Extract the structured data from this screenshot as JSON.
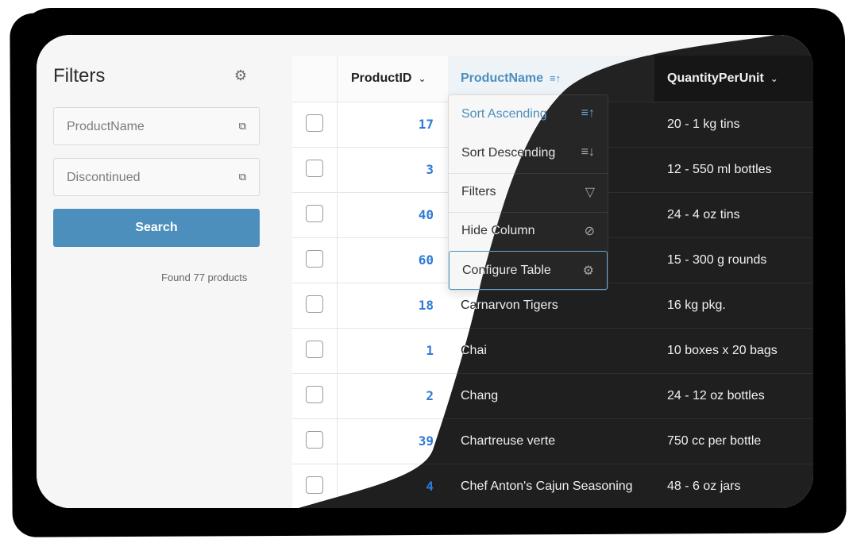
{
  "sidebar": {
    "title": "Filters",
    "fields": [
      {
        "placeholder": "ProductName"
      },
      {
        "placeholder": "Discontinued"
      }
    ],
    "search_label": "Search",
    "found_text": "Found 77 products"
  },
  "table": {
    "columns": [
      {
        "label": "ProductID"
      },
      {
        "label": "ProductName"
      },
      {
        "label": "QuantityPerUnit"
      }
    ],
    "rows": [
      {
        "id": "17",
        "name": "",
        "qty": "20 - 1 kg tins"
      },
      {
        "id": "3",
        "name": "",
        "qty": "12 - 550 ml bottles"
      },
      {
        "id": "40",
        "name": "",
        "qty": "24 - 4 oz tins"
      },
      {
        "id": "60",
        "name": "",
        "qty": "15 - 300 g rounds"
      },
      {
        "id": "18",
        "name": "Carnarvon Tigers",
        "qty": "16 kg pkg."
      },
      {
        "id": "1",
        "name": "Chai",
        "qty": "10 boxes x 20 bags"
      },
      {
        "id": "2",
        "name": "Chang",
        "qty": "24 - 12 oz bottles"
      },
      {
        "id": "39",
        "name": "Chartreuse verte",
        "qty": "750 cc per bottle"
      },
      {
        "id": "4",
        "name": "Chef Anton's Cajun Seasoning",
        "qty": "48 - 6 oz jars"
      }
    ]
  },
  "column_menu": {
    "items": [
      {
        "label": "Sort Ascending",
        "icon": "sort-ascending-icon"
      },
      {
        "label": "Sort Descending",
        "icon": "sort-descending-icon"
      },
      {
        "label": "Filters",
        "icon": "filter-icon"
      },
      {
        "label": "Hide Column",
        "icon": "eye-off-icon"
      },
      {
        "label": "Configure Table",
        "icon": "gear-icon"
      }
    ]
  },
  "colors": {
    "accent": "#4c8fbc",
    "id_blue": "#2e7bd6",
    "dark_bg": "#1f1f1f",
    "light_bg": "#f6f6f7"
  }
}
